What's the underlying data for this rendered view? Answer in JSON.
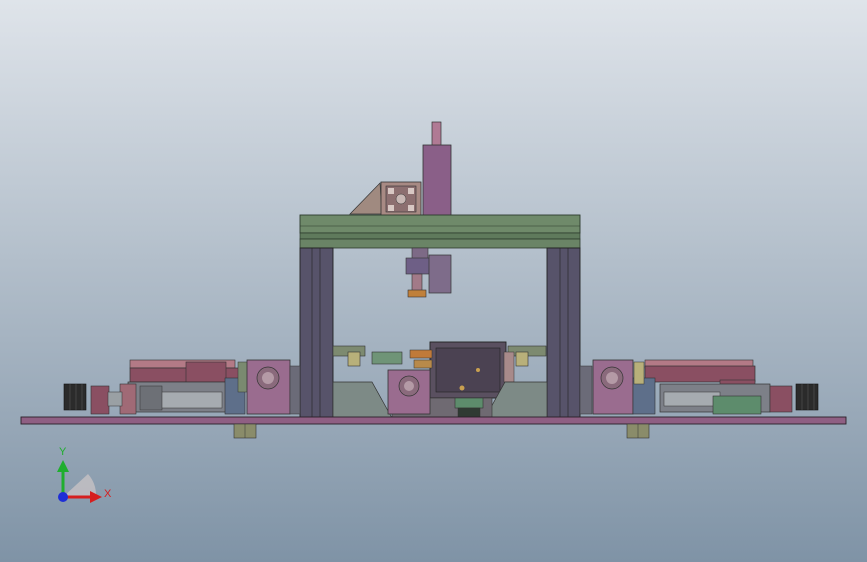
{
  "viewport": {
    "background_top": "#dfe4ea",
    "background_bottom": "#7f93a6"
  },
  "triad": {
    "y_label": "Y",
    "x_label": "X",
    "y_color": "#1fae2e",
    "x_color": "#d61e1e",
    "z_color": "#1e2ed6"
  },
  "palette": {
    "base": "#8f5f83",
    "frame": "#5e5a6e",
    "beam": "#6f8a6a",
    "block": "#8a4f62",
    "mauve": "#9a6c8f",
    "steel": "#9aa0a4",
    "dark": "#2b2b2b",
    "green": "#5d8c6c",
    "tan": "#b89a8c"
  }
}
